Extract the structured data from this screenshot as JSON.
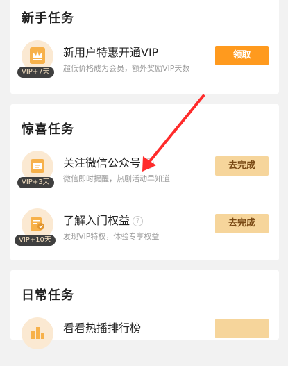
{
  "sections": [
    {
      "title": "新手任务",
      "tasks": [
        {
          "name": "新用户特惠开通VIP",
          "desc": "超低价格成为会员，额外奖励VIP天数",
          "badge": "VIP+7天",
          "button": "领取",
          "icon": "crown-icon"
        }
      ]
    },
    {
      "title": "惊喜任务",
      "tasks": [
        {
          "name": "关注微信公众号",
          "desc": "微信即时提醒，热剧活动早知道",
          "badge": "VIP+3天",
          "button": "去完成",
          "icon": "wechat-follow-icon"
        },
        {
          "name": "了解入门权益",
          "desc": "发现VIP特权，体验专享权益",
          "badge": "VIP+10天",
          "button": "去完成",
          "icon": "privilege-icon"
        }
      ]
    },
    {
      "title": "日常任务",
      "tasks": [
        {
          "name": "看看热播排行榜",
          "button": "",
          "icon": "ranking-icon"
        }
      ]
    }
  ],
  "help_symbol": "?",
  "colors": {
    "accent": "#ff9a1e",
    "button_secondary": "#f6d59b",
    "annotation_arrow": "#ff2b2b"
  }
}
